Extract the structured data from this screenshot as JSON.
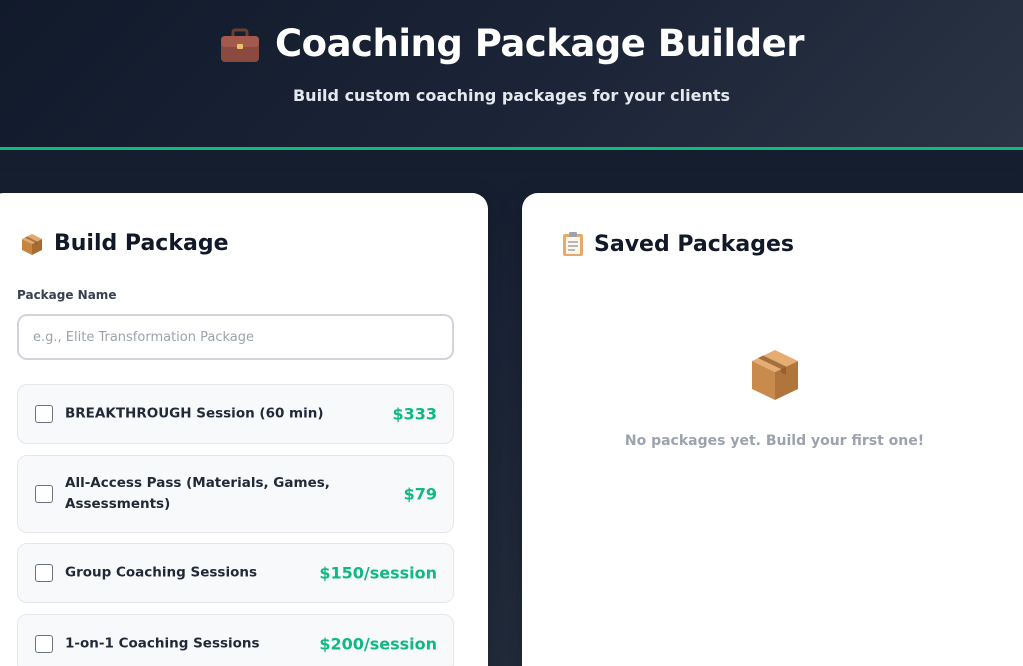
{
  "header": {
    "title": "Coaching Package Builder",
    "subtitle": "Build custom coaching packages for your clients",
    "icon": "briefcase-icon"
  },
  "builder": {
    "heading": "Build Package",
    "heading_icon": "package-icon",
    "package_name_label": "Package Name",
    "package_name_placeholder": "e.g., Elite Transformation Package",
    "package_name_value": "",
    "options": [
      {
        "label": "BREAKTHROUGH Session (60 min)",
        "price": "$333",
        "checked": false
      },
      {
        "label": "All-Access Pass (Materials, Games, Assessments)",
        "price": "$79",
        "checked": false
      },
      {
        "label": "Group Coaching Sessions",
        "price": "$150/session",
        "checked": false
      },
      {
        "label": "1-on-1 Coaching Sessions",
        "price": "$200/session",
        "checked": false
      }
    ]
  },
  "saved": {
    "heading": "Saved Packages",
    "heading_icon": "clipboard-icon",
    "empty_icon": "package-icon",
    "empty_text": "No packages yet. Build your first one!"
  },
  "colors": {
    "accent": "#10b981",
    "header_bg": "#111a2b",
    "card_bg": "#ffffff",
    "price": "#10b981"
  }
}
